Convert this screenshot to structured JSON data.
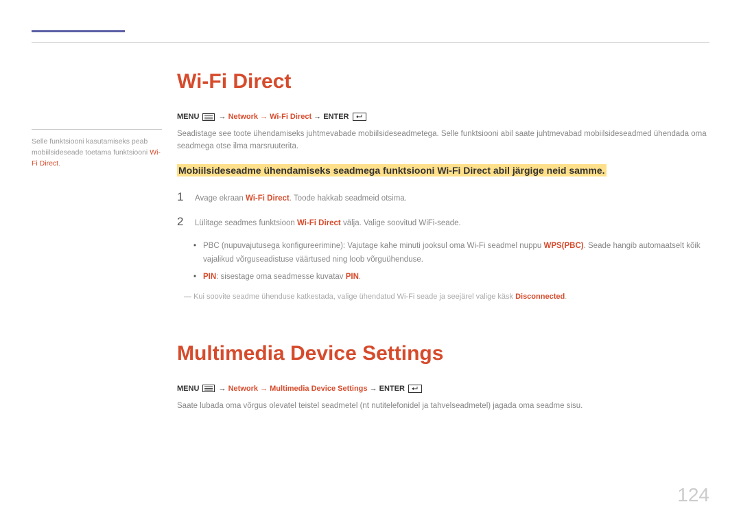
{
  "sidebar": {
    "note_pre": "Selle funktsiooni kasutamiseks peab mobiilsideseade toetama funktsiooni ",
    "note_red": "Wi-Fi Direct",
    "note_post": "."
  },
  "wifi": {
    "heading": "Wi-Fi Direct",
    "crumb": {
      "menu": "MENU",
      "arrow": " → ",
      "path": "Network → Wi-Fi Direct",
      "enter": " → ENTER"
    },
    "intro": "Seadistage see toote ühendamiseks juhtmevabade mobiilsideseadmetega. Selle funktsiooni abil saate juhtmevabad mobiilsideseadmed ühendada oma seadmega otse ilma marsruuterita.",
    "highlight": "Mobiilsideseadme ühendamiseks seadmega funktsiooni Wi-Fi Direct abil järgige neid samme.",
    "steps": [
      {
        "num": "1",
        "pre": "Avage ekraan ",
        "bold": "Wi-Fi Direct",
        "post": ". Toode hakkab seadmeid otsima."
      },
      {
        "num": "2",
        "pre": "Lülitage seadmes funktsioon ",
        "bold": "Wi-Fi Direct",
        "post": " välja. Valige soovitud WiFi-seade."
      }
    ],
    "bullets": [
      {
        "pre": "PBC (nupuvajutusega konfigureerimine): Vajutage kahe minuti jooksul oma Wi-Fi seadmel nuppu ",
        "bold": "WPS(PBC)",
        "post": ". Seade hangib automaatselt kõik vajalikud võrguseadistuse väärtused ning loob võrguühenduse."
      },
      {
        "bold_pre": "PIN",
        "mid": ": sisestage oma seadmesse kuvatav ",
        "bold_post": "PIN",
        "tail": "."
      }
    ],
    "footnote_pre": "Kui soovite seadme ühenduse katkestada, valige ühendatud Wi-Fi seade ja seejärel valige käsk ",
    "footnote_bold": "Disconnected",
    "footnote_post": "."
  },
  "mds": {
    "heading": "Multimedia Device Settings",
    "crumb": {
      "menu": "MENU",
      "arrow": " → ",
      "path": "Network → Multimedia Device Settings",
      "enter": " → ENTER"
    },
    "intro": "Saate lubada oma võrgus olevatel teistel seadmetel (nt nutitelefonidel ja tahvelseadmetel) jagada oma seadme sisu."
  },
  "page_number": "124"
}
